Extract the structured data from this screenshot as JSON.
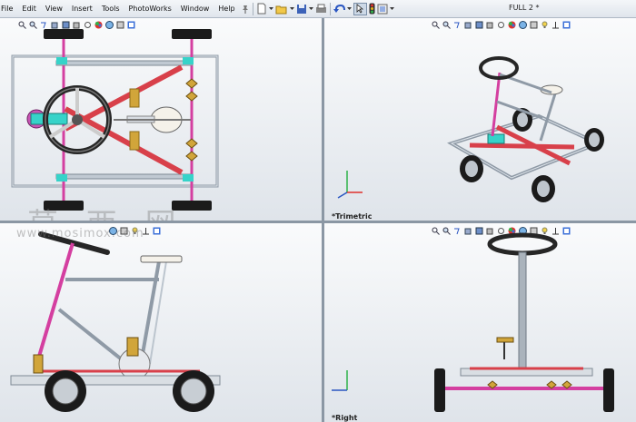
{
  "menu": {
    "items": [
      "File",
      "Edit",
      "View",
      "Insert",
      "Tools",
      "PhotoWorks",
      "Window",
      "Help"
    ]
  },
  "toolbar": {
    "icons": [
      "new-document-icon",
      "open-icon",
      "save-icon",
      "print-icon",
      "undo-icon",
      "select-icon",
      "traffic-light-icon",
      "options-icon"
    ]
  },
  "document": {
    "title": "FULL 2 *"
  },
  "viewports": {
    "top": {
      "label": ""
    },
    "trimetric": {
      "label": "*Trimetric"
    },
    "front": {
      "label": ""
    },
    "right": {
      "label": "*Right"
    }
  },
  "watermark": {
    "text": "莫 西 网",
    "url": "www.mosimox.com"
  },
  "colors": {
    "frame": "#c9d2dc",
    "red_bar": "#d8404a",
    "magenta_rod": "#d43fa0",
    "cyan_joint": "#36d3c9",
    "gold_part": "#d1a53a",
    "tire": "#1b1b1b",
    "accent": "#3a6fd8"
  }
}
